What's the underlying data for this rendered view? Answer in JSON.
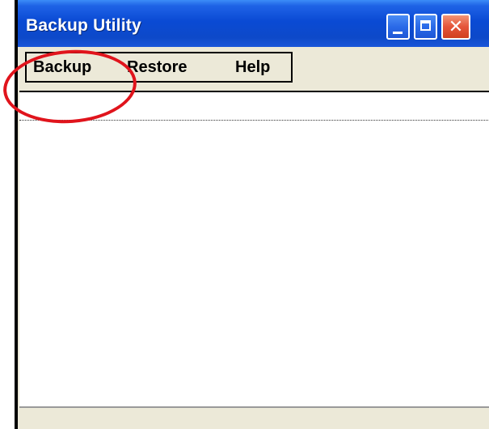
{
  "window": {
    "title": "Backup Utility"
  },
  "titlebar_buttons": {
    "minimize_icon": "minimize-icon",
    "maximize_icon": "maximize-icon",
    "close_icon": "close-icon",
    "close_glyph": "✕"
  },
  "menu": {
    "items": [
      {
        "label": "Backup"
      },
      {
        "label": "Restore"
      },
      {
        "label": "Help"
      }
    ]
  },
  "colors": {
    "titlebar": "#0a4ad4",
    "close_button": "#e5553a",
    "annotation": "#e0141c",
    "window_face": "#ece9d8"
  }
}
